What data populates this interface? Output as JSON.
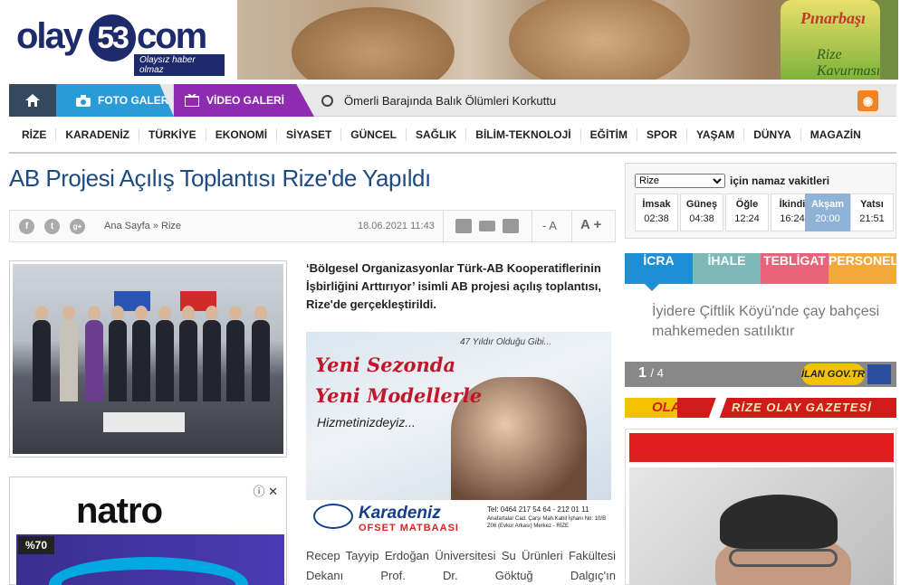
{
  "logo": {
    "part1": "olay",
    "part2": "53",
    "part3": "com",
    "slogan": "Olaysız haber olmaz"
  },
  "top_banner": {
    "brand": "Pınarbaşı",
    "product": "Rize Kavurması"
  },
  "nav": {
    "photo_gallery": "FOTO GALERİ",
    "video_gallery": "VİDEO GALERİ",
    "ticker_headline": "Ömerli Barajında Balık Ölümleri Korkuttu"
  },
  "categories": [
    "RİZE",
    "KARADENİZ",
    "TÜRKİYE",
    "EKONOMİ",
    "SİYASET",
    "GÜNCEL",
    "SAĞLIK",
    "BİLİM-TEKNOLOJİ",
    "EĞİTİM",
    "SPOR",
    "YAŞAM",
    "DÜNYA",
    "MAGAZİN"
  ],
  "article": {
    "title": "AB Projesi Açılış Toplantısı Rize'de Yapıldı",
    "breadcrumb_home": "Ana Sayfa",
    "breadcrumb_sep": "»",
    "breadcrumb_section": "Rize",
    "date": "18.06.2021 11:43",
    "font_decrease": "- A",
    "font_increase": "A +",
    "lead": "‘Bölgesel Organizasyonlar Türk-AB Kooperatiflerinin İşbirliğini Arttırıyor’ isimli AB projesi açılış toplantısı, Rize'de gerçekleştirildi.",
    "body": "Recep Tayyip Erdoğan Üniversitesi Su Ürünleri Fakültesi Dekanı Prof. Dr. Göktuğ Dalgıç'ın"
  },
  "social": {
    "facebook": "f",
    "twitter": "t",
    "google": "g+"
  },
  "ad_left": {
    "brand": "natro",
    "badge": "%70",
    "icons": "ⓘ ✕"
  },
  "ad_mid": {
    "years": "47 Yıldır Olduğu Gibi...",
    "line1": "Yeni Sezonda",
    "line2": "Yeni Modellerle",
    "line3": "Hizmetinizdeyiz...",
    "company1": "Karadeniz",
    "company2": "OFSET MATBAASI",
    "tel": "Tel: 0464 217 54 64 - 212 01 11",
    "address": "Anafartalar Cad. Çarşı Mah.Kabil İşhanı No: 10/B Z06 (Evkur Arkası) Merkez - RİZE"
  },
  "prayer": {
    "city": "Rize",
    "label": "için namaz vakitleri",
    "times": [
      {
        "name": "İmsak",
        "time": "02:38"
      },
      {
        "name": "Güneş",
        "time": "04:38"
      },
      {
        "name": "Öğle",
        "time": "12:24"
      },
      {
        "name": "İkindi",
        "time": "16:24"
      },
      {
        "name": "Akşam",
        "time": "20:00"
      },
      {
        "name": "Yatsı",
        "time": "21:51"
      }
    ]
  },
  "announcements": {
    "tabs": [
      "İCRA",
      "İHALE",
      "TEBLİGAT",
      "PERSONEL A"
    ],
    "colors": [
      "#1e8fd6",
      "#7fb8b8",
      "#e8627a",
      "#f2a93b"
    ],
    "text": "İyidere Çiftlik Köyü'nde çay bahçesi mahkemeden satılıktır",
    "page_current": "1",
    "page_total": "/ 4",
    "ilan_logo": "İLAN GOV.TR"
  },
  "olay_bar": {
    "left": "OLAY",
    "right": "RİZE OLAY GAZETESİ"
  },
  "colors": {
    "brand_blue": "#1e4a83",
    "photo_tab": "#2b9bd8",
    "video_tab": "#8e2bb0",
    "home_tab": "#34495e"
  }
}
